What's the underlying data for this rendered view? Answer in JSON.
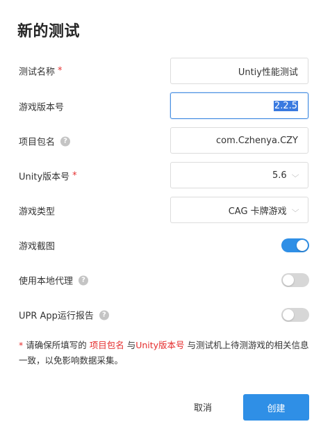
{
  "dialog": {
    "title": "新的测试"
  },
  "form": {
    "test_name": {
      "label": "测试名称",
      "required": "*",
      "value": "Untiy性能测试"
    },
    "game_version": {
      "label": "游戏版本号",
      "value": "2.2.5"
    },
    "package_name": {
      "label": "项目包名",
      "help": "?",
      "value": "com.Czhenya.CZY"
    },
    "unity_version": {
      "label": "Unity版本号",
      "required": "*",
      "value": "5.6"
    },
    "game_type": {
      "label": "游戏类型",
      "value": "CAG 卡牌游戏"
    },
    "screenshot": {
      "label": "游戏截图",
      "enabled": true
    },
    "local_proxy": {
      "label": "使用本地代理",
      "help": "?",
      "enabled": false
    },
    "upr_report": {
      "label": "UPR App运行报告",
      "help": "?",
      "enabled": false
    }
  },
  "note": {
    "prefix": "* 请确保所填写的 ",
    "highlight1": "项目包名",
    "mid": " 与",
    "highlight2": "Unity版本号",
    "suffix": " 与测试机上待测游戏的相关信息一致，以免影响数据采集。"
  },
  "buttons": {
    "cancel": "取消",
    "create": "创建"
  },
  "colors": {
    "accent": "#2f8fe6",
    "required": "#e52d2d",
    "toggle_off": "#d7d7d7"
  }
}
